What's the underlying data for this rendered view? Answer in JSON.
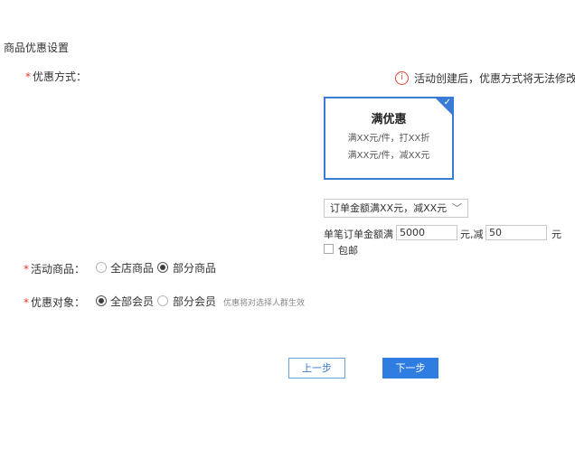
{
  "section_title": "商品优惠设置",
  "discount_method": {
    "required_mark": "*",
    "label": "优惠方式：",
    "notice_icon": "info-icon",
    "notice": "活动创建后，优惠方式将无法修改",
    "card": {
      "title": "满优惠",
      "line1": "满XX元/件，打XX折",
      "line2": "满XX元/件，减XX元",
      "selected_icon": "check-icon"
    },
    "select_value": "订单金额满XX元，减XX元",
    "condition": {
      "prefix": "单笔订单金额满",
      "amount": "5000",
      "middle": "元,减",
      "discount": "50",
      "suffix": "元"
    },
    "free_shipping": {
      "label": "包邮",
      "checked": false
    }
  },
  "activity_goods": {
    "required_mark": "*",
    "label": "活动商品：",
    "options": [
      {
        "label": "全店商品",
        "selected": false
      },
      {
        "label": "部分商品",
        "selected": true
      }
    ]
  },
  "target": {
    "required_mark": "*",
    "label": "优惠对象：",
    "options": [
      {
        "label": "全部会员",
        "selected": true
      },
      {
        "label": "部分会员",
        "selected": false
      }
    ],
    "hint": "优惠将对选择人群生效"
  },
  "buttons": {
    "prev": "上一步",
    "next": "下一步"
  },
  "colors": {
    "accent": "#2f7de1",
    "required": "#e23a2e",
    "notice_icon": "#e0473b"
  }
}
